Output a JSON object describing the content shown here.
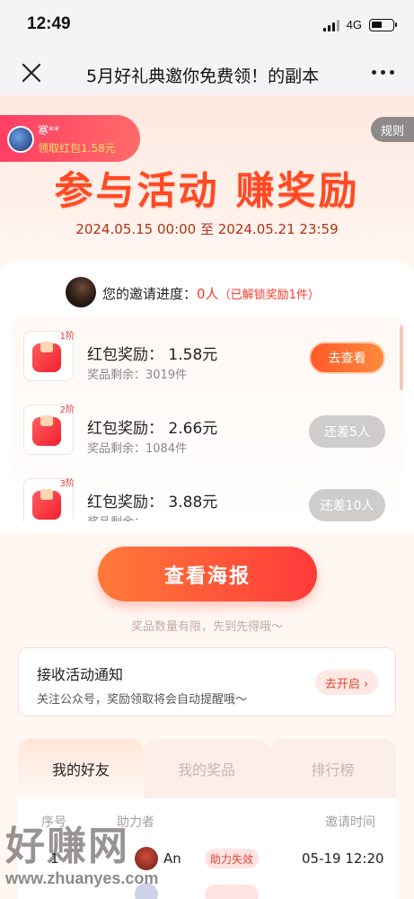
{
  "status_bar": {
    "time": "12:49",
    "network": "4G"
  },
  "nav": {
    "title": "5月好礼典邀你免费领！的副本",
    "close_icon": "close-icon",
    "more_icon": "more-icon"
  },
  "hero": {
    "user_name": "寒**",
    "user_reward": "领取红包1.58元",
    "rules_label": "规则",
    "title": "参与活动 赚奖励",
    "date_range": "2024.05.15 00:00 至 2024.05.21 23:59"
  },
  "invite": {
    "progress_label": "您的邀请进度：",
    "count": "0人",
    "unlocked": "（已解锁奖励1件）"
  },
  "rewards": [
    {
      "tier": "1阶",
      "name": "红包奖励：  1.58元",
      "stock": "奖品剩余：3019件",
      "button": "去查看",
      "active": true
    },
    {
      "tier": "2阶",
      "name": "红包奖励：  2.66元",
      "stock": "奖品剩余：1084件",
      "button": "还差5人",
      "active": false
    },
    {
      "tier": "3阶",
      "name": "红包奖励：  3.88元",
      "stock": "奖品剩余：",
      "button": "还差10人",
      "active": false
    }
  ],
  "poster_button": "查看海报",
  "limit_note": "奖品数量有限，先到先得哦～",
  "notify": {
    "title": "接收活动通知",
    "desc": "关注公众号，奖励领取将会自动提醒哦～",
    "button": "去开启 ›"
  },
  "tabs": [
    {
      "label": "我的好友",
      "active": true
    },
    {
      "label": "我的奖品",
      "active": false
    },
    {
      "label": "排行榜",
      "active": false
    }
  ],
  "table": {
    "headers": {
      "index": "序号",
      "helper": "助力者",
      "time": "邀请时间"
    },
    "rows": [
      {
        "index": "1",
        "name": "An",
        "status": "助力失效",
        "time": "05-19 12:20"
      }
    ]
  },
  "watermark": {
    "logo": "好赚网",
    "url": "www.zhuanyes.com"
  },
  "colors": {
    "accent": "#ff4a24",
    "button_gradient_start": "#ff7a38",
    "button_gradient_end": "#ff3a3a",
    "disabled": "#cfcccc"
  }
}
